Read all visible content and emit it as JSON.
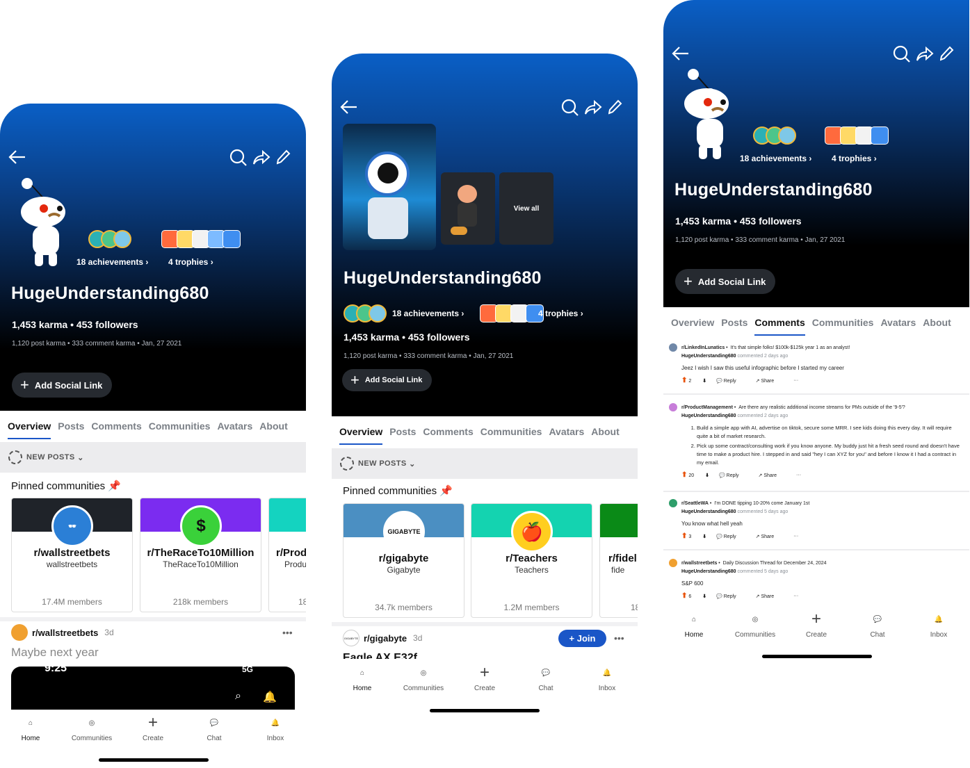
{
  "colors": {
    "accent": "#1a56c7",
    "header_top": "#0a5fc6",
    "upvote": "#e8520b"
  },
  "profile": {
    "username": "HugeUnderstanding680",
    "karma_line": "1,453 karma • 453 followers",
    "sub_line": "1,120 post karma • 333 comment karma • Jan, 27 2021",
    "achievements": "18 achievements",
    "trophies": "4 trophies",
    "view_all": "View all",
    "add_social": "Add Social Link"
  },
  "icons": [
    "back-arrow-icon",
    "search-icon",
    "share-icon",
    "edit-pencil-icon",
    "chevron-right-icon",
    "plus-icon",
    "pin-icon",
    "more-dots-icon"
  ],
  "tabs": [
    "Overview",
    "Posts",
    "Comments",
    "Communities",
    "Avatars",
    "About"
  ],
  "sort_label": "NEW POSTS",
  "pinned_label": "Pinned communities",
  "screen1": {
    "cards": [
      {
        "name": "r/wallstreetbets",
        "sub": "wallstreetbets",
        "members": "17.4M members"
      },
      {
        "name": "r/TheRaceTo10Million",
        "sub": "TheRaceTo10Million",
        "members": "218k members"
      },
      {
        "name": "r/Prod",
        "sub": "Produ",
        "members": "18"
      }
    ],
    "feed": {
      "sub": "r/wallstreetbets",
      "age": "3d",
      "title": "Maybe next year"
    },
    "embedded_status": {
      "time": "9:25",
      "net": "5G"
    }
  },
  "screen2": {
    "cards": [
      {
        "name": "r/gigabyte",
        "sub": "Gigabyte",
        "members": "34.7k members",
        "logo": "GIGABYTE"
      },
      {
        "name": "r/Teachers",
        "sub": "Teachers",
        "members": "1.2M members"
      },
      {
        "name": "r/fidel",
        "sub": "fide",
        "members": "18"
      }
    ],
    "feed": {
      "sub": "r/gigabyte",
      "age": "3d",
      "title": "Eagle AX E32f",
      "join": "Join",
      "logo": "GIGABYTE"
    }
  },
  "screen3": {
    "comments": [
      {
        "sub": "r/LinkedInLunatics",
        "post": "It's that simple folks! $100k-$125k year 1 as an analyst!",
        "user": "HugeUnderstanding680",
        "when": "commented 2 days ago",
        "body": "Jeez I wish I saw this useful infographic before I started my career",
        "votes": "2"
      },
      {
        "sub": "r/ProductManagement",
        "post": "Are there any realistic additional income streams for PMs outside of the '9-5'?",
        "user": "HugeUnderstanding680",
        "when": "commented 2 days ago",
        "list": [
          "Build a simple app with AI, advertise on tiktok, secure some MRR. I see kids doing this every day. It will require quite a bit of market research.",
          "Pick up some contract/consulting work if you know anyone. My buddy just hit a fresh seed round and doesn't have time to make a product hire. I stepped in and said \"hey I can XYZ for you\" and before I know it I had a contract in my email."
        ],
        "votes": "20"
      },
      {
        "sub": "r/SeattleWA",
        "post": "I'm DONE tipping 10-20% come January 1st",
        "user": "HugeUnderstanding680",
        "when": "commented 5 days ago",
        "body": "You know what hell yeah",
        "votes": "3"
      },
      {
        "sub": "r/wallstreetbets",
        "post": "Daily Discussion Thread for December 24, 2024",
        "user": "HugeUnderstanding680",
        "when": "commented 5 days ago",
        "body": "S&P 600",
        "votes": "6"
      }
    ],
    "reply": "Reply",
    "share": "Share",
    "more": "···"
  },
  "nav": [
    "Home",
    "Communities",
    "Create",
    "Chat",
    "Inbox"
  ]
}
